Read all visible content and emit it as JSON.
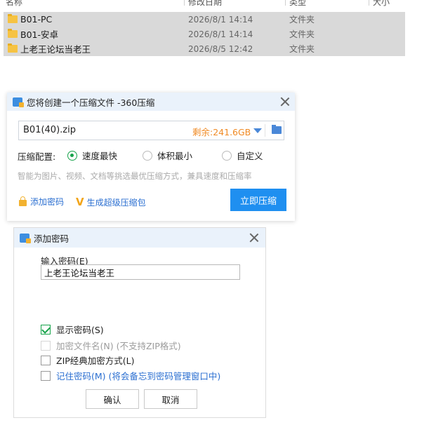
{
  "explorer": {
    "columns": [
      "名称",
      "修改日期",
      "类型",
      "大小"
    ],
    "files": [
      {
        "name": "B01-PC",
        "date": "2026/8/1 14:14",
        "type": "文件夹",
        "icon": "folder-icon"
      },
      {
        "name": "B01-安卓",
        "date": "2026/8/1 14:14",
        "type": "文件夹",
        "icon": "folder-icon"
      },
      {
        "name": "上老王论坛当老王",
        "date": "2026/8/5 12:42",
        "type": "文件夹",
        "icon": "folder-icon"
      }
    ]
  },
  "compress_dialog": {
    "title": "您将创建一个压缩文件 -360压缩",
    "filename": "B01(40).zip",
    "free_space": "剩余:241.6GB",
    "config_label": "压缩配置:",
    "options": [
      {
        "label": "速度最快",
        "selected": true
      },
      {
        "label": "体积最小",
        "selected": false
      },
      {
        "label": "自定义",
        "selected": false
      }
    ],
    "hint": "智能为图片、视频、文档等挑选最优压缩方式，兼具速度和压缩率",
    "add_password_label": "添加密码",
    "super_compress_label": "生成超级压缩包",
    "compress_button": "立即压缩",
    "accent_color": "#1f8ff0"
  },
  "password_dialog": {
    "title": "添加密码",
    "field_label": "输入密码(E)",
    "password_value": "上老王论坛当老王",
    "checkboxes": [
      {
        "label": "显示密码(S)",
        "checked": true,
        "enabled": true
      },
      {
        "label": "加密文件名(N) (不支持ZIP格式)",
        "checked": false,
        "enabled": false
      },
      {
        "label": "ZIP经典加密方式(L)",
        "checked": false,
        "enabled": true
      },
      {
        "label": "记住密码(M) (将会备忘到密码管理窗口中)",
        "checked": false,
        "enabled": true
      }
    ],
    "ok_button": "确认",
    "cancel_button": "取消"
  }
}
